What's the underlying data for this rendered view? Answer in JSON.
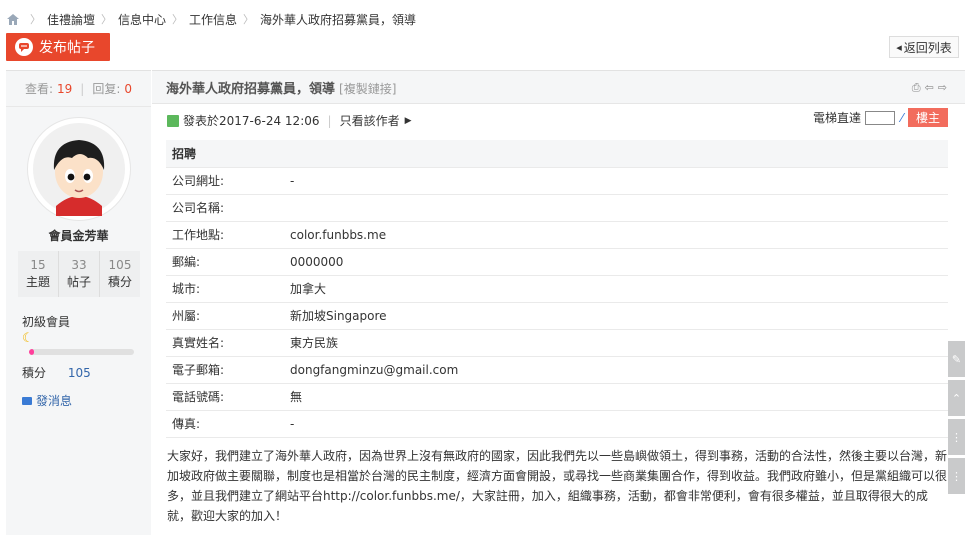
{
  "breadcrumb": {
    "items": [
      "佳禮論壇",
      "信息中心",
      "工作信息",
      "海外華人政府招募黨員，領導"
    ]
  },
  "actions": {
    "post_label": "发布帖子",
    "back_label": "返回列表"
  },
  "sidebar": {
    "views_label": "查看:",
    "views": "19",
    "replies_label": "回复:",
    "replies": "0",
    "username": "會員金芳華",
    "stats": [
      {
        "value": "15",
        "label": "主題"
      },
      {
        "value": "33",
        "label": "帖子"
      },
      {
        "value": "105",
        "label": "積分"
      }
    ],
    "level": "初級會員",
    "level_progress_fraction": 0.05,
    "points_label": "積分",
    "points": "105",
    "message_label": "發消息"
  },
  "post": {
    "title": "海外華人政府招募黨員，領導",
    "copy_link": "[複製鏈接]",
    "published": "發表於2017-6-24 12:06",
    "only_author": "只看該作者",
    "jump_label": "電梯直達",
    "floor_label": "樓主",
    "info_header": "招聘",
    "fields": [
      {
        "key": "公司網址:",
        "value": "-"
      },
      {
        "key": "公司名稱:",
        "value": ""
      },
      {
        "key": "工作地點:",
        "value": "color.funbbs.me"
      },
      {
        "key": "郵編:",
        "value": "0000000"
      },
      {
        "key": "城市:",
        "value": "加拿大"
      },
      {
        "key": "州屬:",
        "value": "新加坡Singapore"
      },
      {
        "key": "真實姓名:",
        "value": "東方民族"
      },
      {
        "key": "電子郵箱:",
        "value": "dongfangminzu@gmail.com"
      },
      {
        "key": "電話號碼:",
        "value": "無"
      },
      {
        "key": "傳真:",
        "value": "-"
      }
    ],
    "body": "大家好，我們建立了海外華人政府，因為世界上沒有無政府的國家，因此我們先以一些島嶼做領土，得到事務，活動的合法性，然後主要以台灣，新加坡政府做主要關聯，制度也是相當於台灣的民主制度，經濟方面會開設，或尋找一些商業集團合作，得到收益。我們政府雖小，但是黨組織可以很多，並且我們建立了網站平台http://color.funbbs.me/，大家註冊，加入，組織事務，活動，都會非常便利，會有很多權益，並且取得很大的成就，歡迎大家的加入！"
  },
  "colors": {
    "accent": "#e8472c",
    "floor": "#f26c5d",
    "link": "#3366aa",
    "progress": "#ff3e9b"
  }
}
